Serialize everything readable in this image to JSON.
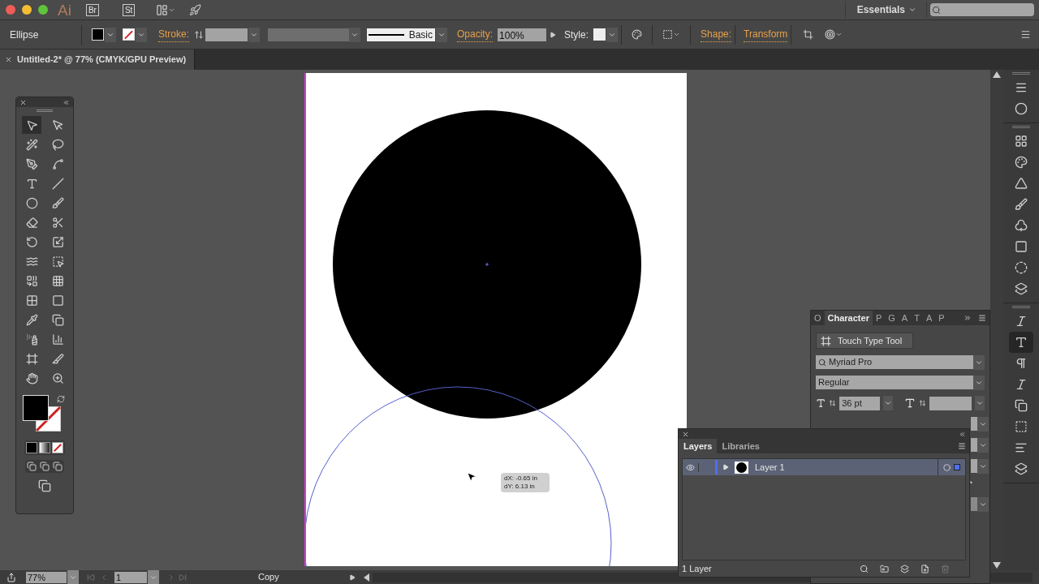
{
  "app_bar": {
    "logo": "Ai",
    "bridge": "Br",
    "stock": "St",
    "workspace": "Essentials"
  },
  "control_bar": {
    "object": "Ellipse",
    "stroke_label": "Stroke:",
    "brush": "Basic",
    "opacity_label": "Opacity:",
    "opacity": "100%",
    "style_label": "Style:",
    "shape_link": "Shape:",
    "transform_link": "Transform"
  },
  "document_tab": {
    "title": "Untitled-2* @ 77% (CMYK/GPU Preview)"
  },
  "tools": [
    {
      "selected": true
    },
    {
      "selected": false
    },
    {
      "selected": false
    },
    {
      "selected": false
    },
    {
      "selected": false
    },
    {
      "selected": false
    },
    {
      "selected": false
    },
    {
      "selected": false
    },
    {
      "selected": false
    },
    {
      "selected": false
    },
    {
      "selected": false
    },
    {
      "selected": false
    },
    {
      "selected": false
    },
    {
      "selected": false
    },
    {
      "selected": false
    },
    {
      "selected": false
    },
    {
      "selected": false
    },
    {
      "selected": false
    },
    {
      "selected": false
    },
    {
      "selected": false
    },
    {
      "selected": false
    },
    {
      "selected": false
    },
    {
      "selected": false
    },
    {
      "selected": false
    },
    {
      "selected": false
    },
    {
      "selected": false
    },
    {
      "selected": false
    },
    {
      "selected": false
    }
  ],
  "canvas": {
    "tooltip": [
      "dX: -0.65 in",
      "dY: 6.13 in"
    ]
  },
  "character_panel": {
    "tabs": [
      {
        "label": "O",
        "selected": false
      },
      {
        "label": "Character",
        "selected": true
      },
      {
        "label": "P",
        "selected": false
      },
      {
        "label": "G",
        "selected": false
      },
      {
        "label": "A",
        "selected": false
      },
      {
        "label": "T",
        "selected": false
      },
      {
        "label": "A",
        "selected": false
      },
      {
        "label": "P",
        "selected": false
      }
    ],
    "touch_type": "Touch Type Tool",
    "font_family": "Myriad Pro",
    "font_style": "Regular",
    "font_size": "36 pt"
  },
  "layers_panel": {
    "tabs": [
      {
        "label": "Layers",
        "selected": true
      },
      {
        "label": "Libraries",
        "selected": false
      }
    ],
    "layers": [
      {
        "name": "Layer 1",
        "visible": true,
        "expanded": false,
        "selected": true,
        "color": "#4f6ff0"
      }
    ],
    "count": "1 Layer"
  },
  "dock": {
    "groups": [
      {
        "items": [
          {
            "selected": false
          },
          {
            "selected": false
          }
        ]
      },
      {
        "items": [
          {
            "selected": false
          },
          {
            "selected": false
          },
          {
            "selected": false
          },
          {
            "selected": false
          },
          {
            "selected": false
          },
          {
            "selected": false
          },
          {
            "selected": false
          },
          {
            "selected": false
          }
        ]
      },
      {
        "items": [
          {
            "selected": false
          },
          {
            "selected": true
          },
          {
            "selected": false
          },
          {
            "selected": false
          },
          {
            "selected": false
          },
          {
            "selected": false
          },
          {
            "selected": false
          },
          {
            "selected": false
          }
        ]
      }
    ]
  },
  "status_bar": {
    "zoom": "77%",
    "artboard": "1",
    "mode": "Copy"
  }
}
